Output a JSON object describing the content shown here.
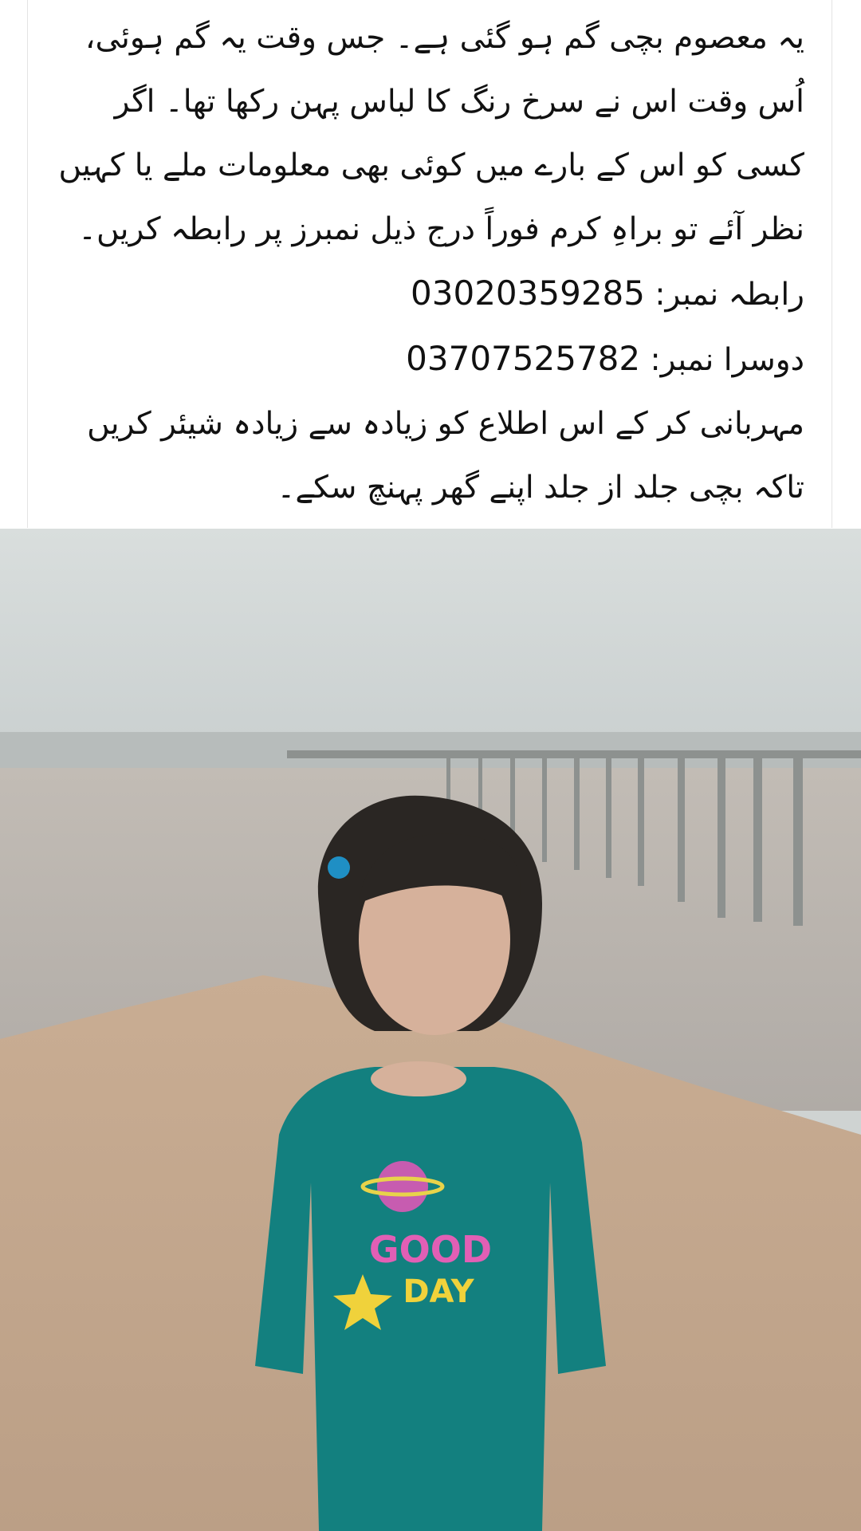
{
  "post": {
    "paragraph_1": "یہ معصوم بچی گم ہو گئی ہے۔ جس وقت یہ گم ہوئی، اُس وقت اس نے سرخ رنگ کا لباس پہن رکھا تھا۔ اگر کسی کو اس کے بارے میں کوئی بھی معلومات ملے یا کہیں نظر آئے تو براہِ کرم فوراً درج ذیل نمبرز پر رابطہ کریں۔",
    "contact_label": "رابطہ نمبر:",
    "contact_number": "03020359285",
    "second_label": "دوسرا نمبر:",
    "second_number": "03707525782",
    "paragraph_2": "مہربانی کر کے اس اطلاع کو زیادہ سے زیادہ شیئر کریں تاکہ بچی جلد از جلد اپنے گھر پہنچ سکے۔"
  },
  "photo": {
    "shirt_text_1": "GOOD",
    "shirt_text_2": "DAY"
  },
  "colors": {
    "text": "#111111",
    "sky": "#d6dcdc",
    "water": "#b9b4ad",
    "ground": "#c3a88e",
    "shirt": "#13807f"
  }
}
